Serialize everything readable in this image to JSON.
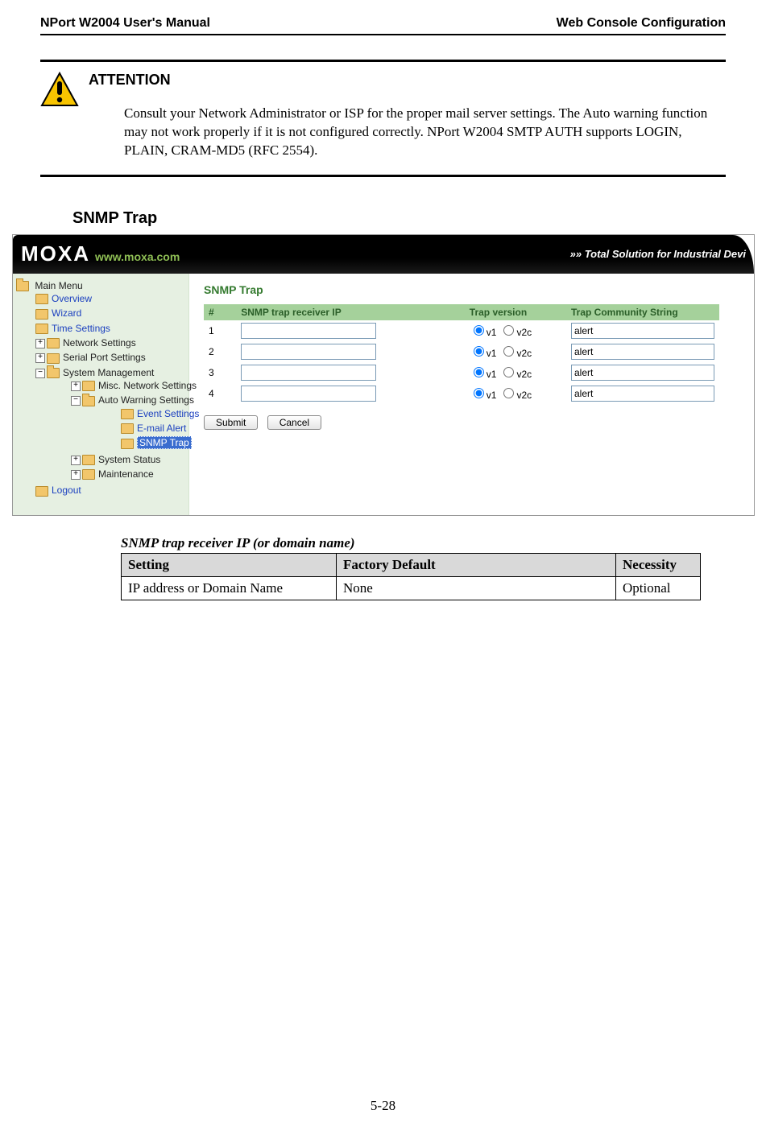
{
  "header": {
    "left": "NPort W2004 User's Manual",
    "right": "Web Console Configuration"
  },
  "attention": {
    "title": "ATTENTION",
    "body": "Consult your Network Administrator or ISP for the proper mail server settings. The Auto warning function may not work properly if it is not configured correctly. NPort W2004 SMTP AUTH supports LOGIN, PLAIN, CRAM-MD5 (RFC 2554)."
  },
  "section": {
    "title": "SNMP Trap"
  },
  "banner": {
    "brand": "MOXA",
    "url": "www.moxa.com",
    "tagline_prefix": "»»",
    "tagline": "Total Solution for Industrial Devi"
  },
  "nav": {
    "root": "Main Menu",
    "overview": "Overview",
    "wizard": "Wizard",
    "time": "Time Settings",
    "network": "Network Settings",
    "serial": "Serial Port Settings",
    "sysmgmt": "System Management",
    "miscnet": "Misc. Network Settings",
    "autowarn": "Auto Warning Settings",
    "event": "Event Settings",
    "email": "E-mail Alert",
    "snmp": "SNMP Trap",
    "sysstatus": "System Status",
    "maint": "Maintenance",
    "logout": "Logout",
    "plus": "+",
    "minus": "−"
  },
  "pane": {
    "title": "SNMP Trap",
    "headers": {
      "num": "#",
      "ip": "SNMP trap receiver IP",
      "ver": "Trap version",
      "comm": "Trap Community String"
    },
    "rows": [
      {
        "n": "1",
        "ip": "",
        "v1": true,
        "v1label": "v1",
        "v2label": "v2c",
        "comm": "alert"
      },
      {
        "n": "2",
        "ip": "",
        "v1": true,
        "v1label": "v1",
        "v2label": "v2c",
        "comm": "alert"
      },
      {
        "n": "3",
        "ip": "",
        "v1": true,
        "v1label": "v1",
        "v2label": "v2c",
        "comm": "alert"
      },
      {
        "n": "4",
        "ip": "",
        "v1": true,
        "v1label": "v1",
        "v2label": "v2c",
        "comm": "alert"
      }
    ],
    "submit": "Submit",
    "cancel": "Cancel"
  },
  "caption": "SNMP trap receiver IP (or domain name)",
  "table": {
    "h1": "Setting",
    "h2": "Factory Default",
    "h3": "Necessity",
    "r1c1": "IP address or Domain Name",
    "r1c2": "None",
    "r1c3": "Optional"
  },
  "pagenum": "5-28"
}
